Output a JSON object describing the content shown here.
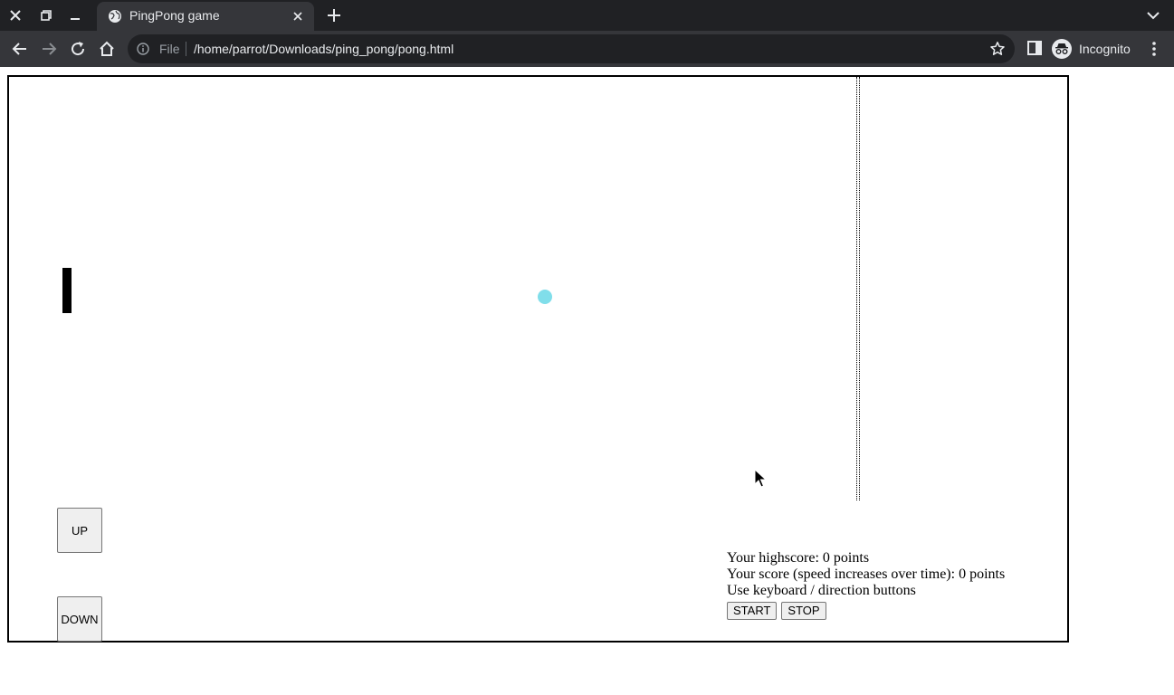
{
  "browser": {
    "tab": {
      "title": "PingPong game",
      "icon": "globe-icon"
    },
    "address_bar": {
      "scheme_label": "File",
      "url": "/home/parrot/Downloads/ping_pong/pong.html"
    },
    "profile_label": "Incognito"
  },
  "game": {
    "ball_color": "#80deea",
    "paddle_color": "#000000"
  },
  "controls": {
    "up_label": "UP",
    "down_label": "DOWN",
    "highscore_text": "Your highscore: 0 points",
    "score_text": "Your score (speed increases over time): 0 points",
    "hint_text": "Use keyboard / direction buttons",
    "start_label": "START",
    "stop_label": "STOP"
  }
}
